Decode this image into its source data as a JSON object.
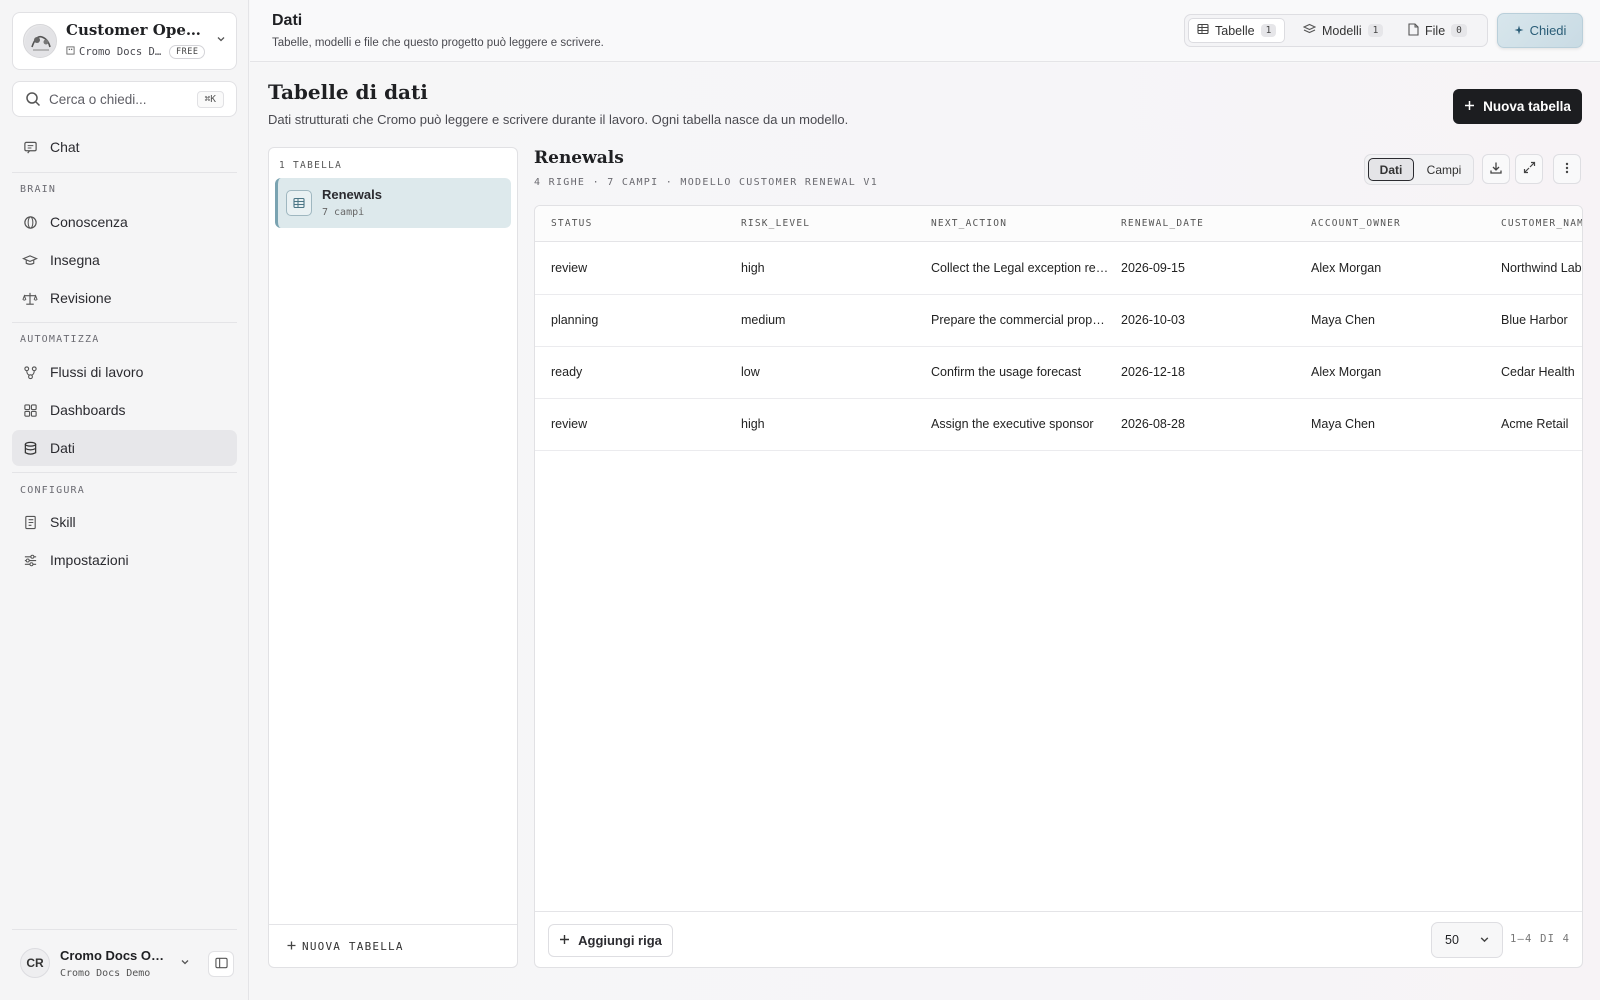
{
  "workspace": {
    "title": "Customer Operations",
    "org": "Cromo Docs Demo",
    "plan": "FREE"
  },
  "search": {
    "placeholder": "Cerca o chiedi...",
    "shortcut": "⌘K"
  },
  "sidebar": {
    "chat": "Chat",
    "brain_label": "BRAIN",
    "brain_items": [
      "Conoscenza",
      "Insegna",
      "Revisione"
    ],
    "automate_label": "AUTOMATIZZA",
    "automate_items": [
      "Flussi di lavoro",
      "Dashboards",
      "Dati"
    ],
    "configure_label": "CONFIGURA",
    "configure_items": [
      "Skill",
      "Impostazioni"
    ],
    "active": "Dati"
  },
  "user": {
    "initials": "CR",
    "name": "Cromo Docs Owner",
    "org": "Cromo Docs Demo"
  },
  "header": {
    "title": "Dati",
    "subtitle": "Tabelle, modelli e file che questo progetto può leggere e scrivere.",
    "tabs": [
      {
        "label": "Tabelle",
        "count": "1",
        "active": true
      },
      {
        "label": "Modelli",
        "count": "1",
        "active": false
      },
      {
        "label": "File",
        "count": "0",
        "active": false
      }
    ],
    "ask_label": "Chiedi"
  },
  "page": {
    "title": "Tabelle di dati",
    "subtitle": "Dati strutturati che Cromo può leggere e scrivere durante il lavoro. Ogni tabella nasce da un modello.",
    "new_table_label": "Nuova tabella"
  },
  "tables_panel": {
    "count_label": "1 TABELLA",
    "items": [
      {
        "name": "Renewals",
        "fields": "7 campi"
      }
    ],
    "new_label": "NUOVA TABELLA"
  },
  "table": {
    "name": "Renewals",
    "meta": "4 RIGHE · 7 CAMPI · MODELLO CUSTOMER RENEWAL V1",
    "view_data": "Dati",
    "view_fields": "Campi",
    "columns": [
      "STATUS",
      "RISK_LEVEL",
      "NEXT_ACTION",
      "RENEWAL_DATE",
      "ACCOUNT_OWNER",
      "CUSTOMER_NAME"
    ],
    "rows": [
      [
        "review",
        "high",
        "Collect the Legal exception request",
        "2026-09-15",
        "Alex Morgan",
        "Northwind Labs"
      ],
      [
        "planning",
        "medium",
        "Prepare the commercial proposal",
        "2026-10-03",
        "Maya Chen",
        "Blue Harbor"
      ],
      [
        "ready",
        "low",
        "Confirm the usage forecast",
        "2026-12-18",
        "Alex Morgan",
        "Cedar Health"
      ],
      [
        "review",
        "high",
        "Assign the executive sponsor",
        "2026-08-28",
        "Maya Chen",
        "Acme Retail"
      ]
    ],
    "add_row_label": "Aggiungi riga",
    "page_size": "50",
    "range": "1–4 DI 4"
  }
}
